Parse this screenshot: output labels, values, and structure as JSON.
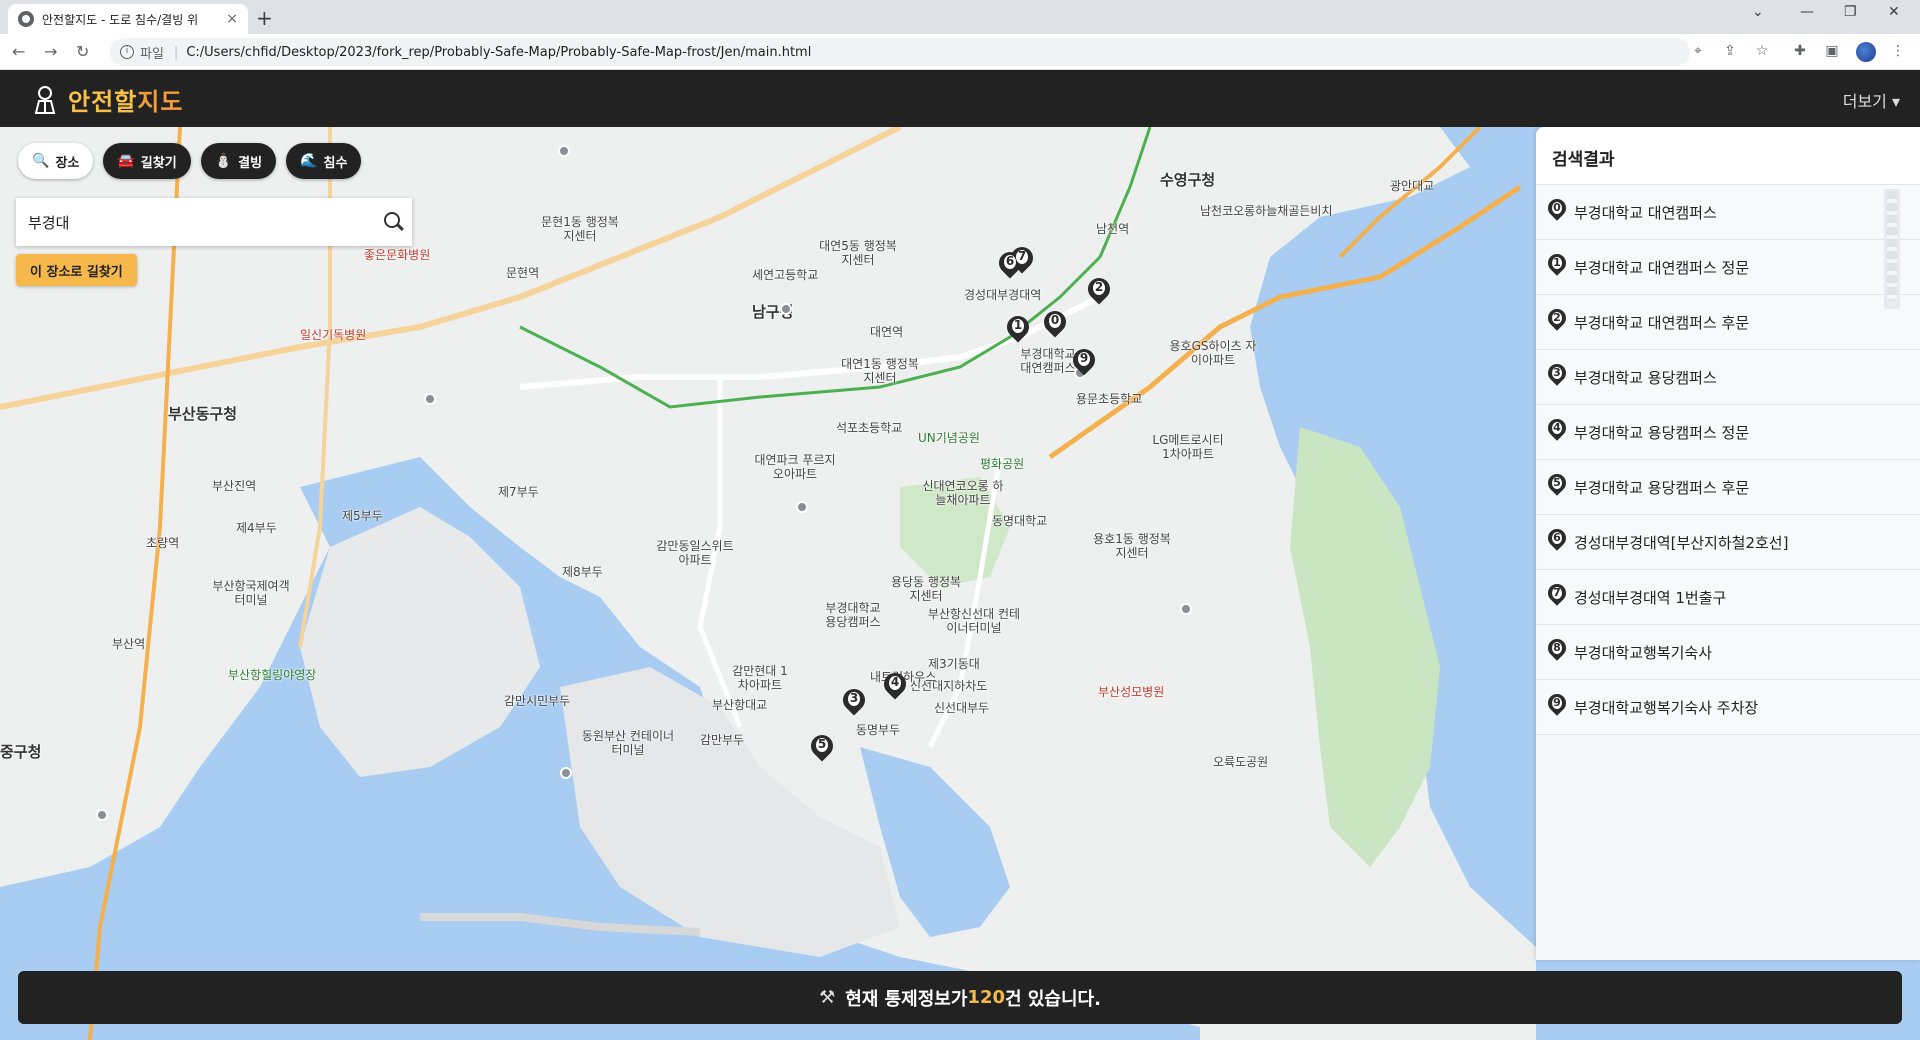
{
  "browser": {
    "tab_title": "안전할지도 - 도로 침수/결빙 위",
    "tab_close": "×",
    "new_tab": "+",
    "url_protocol": "파일",
    "url": "C:/Users/chfid/Desktop/2023/fork_rep/Probably-Safe-Map/Probably-Safe-Map-frost/Jen/main.html"
  },
  "header": {
    "logo_part1": "안전할",
    "logo_part2": "지도",
    "more_label": "더보기 ▾"
  },
  "search_panel": {
    "modes": [
      {
        "label": "장소",
        "icon": "search-icon"
      },
      {
        "label": "길찾기",
        "icon": "car-icon"
      },
      {
        "label": "결빙",
        "icon": "snowman-icon"
      },
      {
        "label": "침수",
        "icon": "flood-icon"
      }
    ],
    "query": "부경대",
    "route_button": "이 장소로 길찾기"
  },
  "results": {
    "title": "검색결과",
    "items": [
      {
        "num": "0",
        "name": "부경대학교 대연캠퍼스"
      },
      {
        "num": "1",
        "name": "부경대학교 대연캠퍼스 정문"
      },
      {
        "num": "2",
        "name": "부경대학교 대연캠퍼스 후문"
      },
      {
        "num": "3",
        "name": "부경대학교 용당캠퍼스"
      },
      {
        "num": "4",
        "name": "부경대학교 용당캠퍼스 정문"
      },
      {
        "num": "5",
        "name": "부경대학교 용당캠퍼스 후문"
      },
      {
        "num": "6",
        "name": "경성대부경대역[부산지하철2호선]"
      },
      {
        "num": "7",
        "name": "경성대부경대역 1번출구"
      },
      {
        "num": "8",
        "name": "부경대학교행복기숙사"
      },
      {
        "num": "9",
        "name": "부경대학교행복기숙사 주차장"
      }
    ]
  },
  "map": {
    "labels": [
      {
        "text": "남구청",
        "cls": "big"
      },
      {
        "text": "수영구청",
        "cls": "big"
      },
      {
        "text": "부산동구청",
        "cls": "big"
      },
      {
        "text": "중구청",
        "cls": "big"
      },
      {
        "text": "광안대교",
        "cls": ""
      },
      {
        "text": "남천역",
        "cls": ""
      },
      {
        "text": "문현역",
        "cls": ""
      },
      {
        "text": "대연역",
        "cls": ""
      },
      {
        "text": "경성대부경대역",
        "cls": ""
      },
      {
        "text": "부경대학교 대연캠퍼스",
        "cls": ""
      },
      {
        "text": "부경대학교 용당캠퍼스",
        "cls": ""
      },
      {
        "text": "UN기념공원",
        "cls": "green"
      },
      {
        "text": "평화공원",
        "cls": "green"
      },
      {
        "text": "LG메트로시티 1차아파트",
        "cls": ""
      },
      {
        "text": "용호1동 행정복지센터",
        "cls": ""
      },
      {
        "text": "용당동 행정복지센터",
        "cls": ""
      },
      {
        "text": "감만동일스위트 아파트",
        "cls": ""
      },
      {
        "text": "부산항대교",
        "cls": ""
      },
      {
        "text": "신선대부두",
        "cls": ""
      },
      {
        "text": "감만부두",
        "cls": ""
      },
      {
        "text": "동명부두",
        "cls": ""
      },
      {
        "text": "제7부두",
        "cls": ""
      },
      {
        "text": "제5부두",
        "cls": ""
      },
      {
        "text": "제4부두",
        "cls": ""
      },
      {
        "text": "제8부두",
        "cls": ""
      },
      {
        "text": "부산역",
        "cls": ""
      },
      {
        "text": "초량역",
        "cls": ""
      },
      {
        "text": "부산진역",
        "cls": ""
      },
      {
        "text": "좋은문화병원",
        "cls": "red"
      },
      {
        "text": "일신기독병원",
        "cls": "red"
      },
      {
        "text": "부산성모병원",
        "cls": "red"
      },
      {
        "text": "부산항힐링야영장",
        "cls": "green"
      },
      {
        "text": "오륙도공원",
        "cls": ""
      },
      {
        "text": "세연고등학교",
        "cls": ""
      },
      {
        "text": "대연5동 행정복지센터",
        "cls": ""
      },
      {
        "text": "대연1동 행정복지센터",
        "cls": ""
      },
      {
        "text": "용호GS하이츠 자이아파트",
        "cls": ""
      },
      {
        "text": "남천코오롱하늘채골든비치",
        "cls": ""
      },
      {
        "text": "신대연코오롱 하늘채아파트",
        "cls": ""
      },
      {
        "text": "동명대학교",
        "cls": ""
      },
      {
        "text": "용문초등학교",
        "cls": ""
      },
      {
        "text": "석포초등학교",
        "cls": ""
      },
      {
        "text": "감만현대 1차아파트",
        "cls": ""
      },
      {
        "text": "부산항신선대 컨테이너터미널",
        "cls": ""
      },
      {
        "text": "동원부산 컨테이너터미널",
        "cls": ""
      },
      {
        "text": "신선대지하차도",
        "cls": ""
      },
      {
        "text": "제3기동대",
        "cls": ""
      },
      {
        "text": "대연파크 푸르지오아파트",
        "cls": ""
      },
      {
        "text": "감만시민부두",
        "cls": ""
      },
      {
        "text": "내트럭하우스",
        "cls": ""
      },
      {
        "text": "부산항국제여객 터미널",
        "cls": ""
      },
      {
        "text": "문현1동 행정복지센터",
        "cls": ""
      }
    ],
    "markers": [
      "0",
      "1",
      "2",
      "3",
      "4",
      "5",
      "6",
      "7",
      "9"
    ]
  },
  "notice": {
    "prefix": "현재 통제정보가 ",
    "count": "120",
    "suffix": "건 있습니다."
  }
}
